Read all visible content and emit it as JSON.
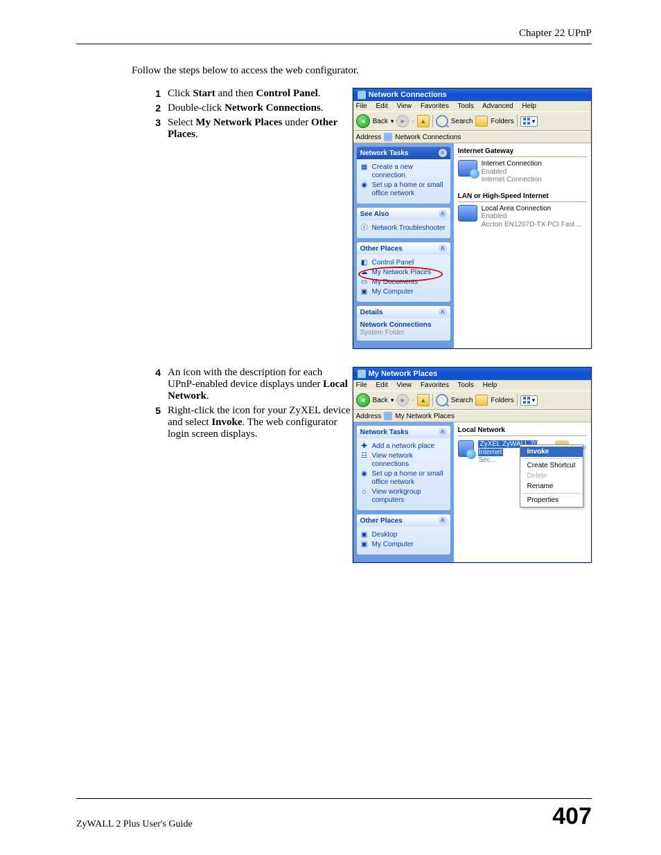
{
  "header": {
    "chapter": "Chapter 22 UPnP"
  },
  "intro": "Follow the steps below to access the web configurator.",
  "stepsA": [
    {
      "n": "1",
      "pre": "Click ",
      "b1": "Start",
      "mid": " and then ",
      "b2": "Control Panel",
      "post": "."
    },
    {
      "n": "2",
      "pre": "Double-click ",
      "b1": "Network Connections",
      "mid": "",
      "b2": "",
      "post": "."
    },
    {
      "n": "3",
      "pre": "Select ",
      "b1": "My Network Places",
      "mid": " under ",
      "b2": "Other Places",
      "post": "."
    }
  ],
  "stepsB": [
    {
      "n": "4",
      "plain1": "An icon with the description for each UPnP-enabled device displays under ",
      "bold": "Local Network",
      "plain2": "."
    },
    {
      "n": "5",
      "plain1": "Right-click the icon for your ZyXEL device and select ",
      "bold": "Invoke",
      "plain2": ". The web configurator login screen displays."
    }
  ],
  "win1": {
    "title": "Network Connections",
    "menu": [
      "File",
      "Edit",
      "View",
      "Favorites",
      "Tools",
      "Advanced",
      "Help"
    ],
    "toolbar": {
      "back": "Back",
      "search": "Search",
      "folders": "Folders"
    },
    "addressLabel": "Address",
    "addressValue": "Network Connections",
    "panels": {
      "tasks": {
        "title": "Network Tasks",
        "items": [
          "Create a new connection",
          "Set up a home or small office network"
        ]
      },
      "seeAlso": {
        "title": "See Also",
        "items": [
          "Network Troubleshooter"
        ]
      },
      "other": {
        "title": "Other Places",
        "items": [
          "Control Panel",
          "My Network Places",
          "My Documents",
          "My Computer"
        ]
      },
      "details": {
        "title": "Details",
        "line1": "Network Connections",
        "line2": "System Folder"
      }
    },
    "right": {
      "sec1": "Internet Gateway",
      "conn1": {
        "name": "Internet Connection",
        "status": "Enabled",
        "via": "Internet Connection"
      },
      "sec2": "LAN or High-Speed Internet",
      "conn2": {
        "name": "Local Area Connection",
        "status": "Enabled",
        "via": "Accton EN1207D-TX PCI Fast ..."
      }
    }
  },
  "win2": {
    "title": "My Network Places",
    "menu": [
      "File",
      "Edit",
      "View",
      "Favorites",
      "Tools",
      "Help"
    ],
    "toolbar": {
      "back": "Back",
      "search": "Search",
      "folders": "Folders"
    },
    "addressLabel": "Address",
    "addressValue": "My Network Places",
    "panels": {
      "tasks": {
        "title": "Network Tasks",
        "items": [
          "Add a network place",
          "View network connections",
          "Set up a home or small office network",
          "View workgroup computers"
        ]
      },
      "other": {
        "title": "Other Places",
        "items": [
          "Desktop",
          "My Computer"
        ]
      }
    },
    "right": {
      "sec": "Local Network",
      "device": "ZyXEL ZyWALL 70 Internet",
      "ctx": [
        "Invoke",
        "Create Shortcut",
        "Delete",
        "Rename",
        "Properties"
      ],
      "gatewayHint": "Gate"
    }
  },
  "footer": {
    "guide": "ZyWALL 2 Plus User's Guide",
    "page": "407"
  }
}
